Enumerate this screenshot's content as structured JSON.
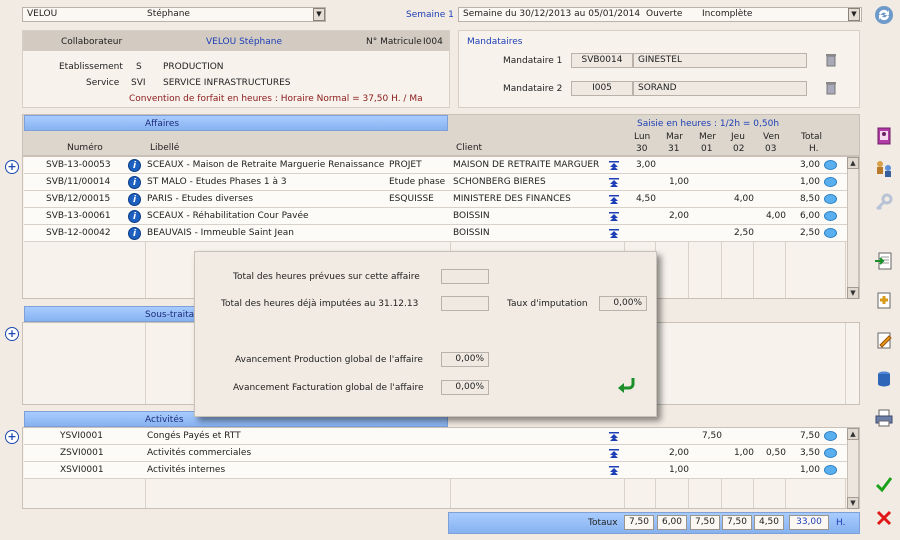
{
  "header": {
    "collaborator_select": "VELOU",
    "collaborator_firstname": "Stéphane",
    "week_label": "Semaine 1",
    "week_select": "Semaine du 30/12/2013 au 05/01/2014",
    "week_state": "Ouverte",
    "week_status": "Incomplète"
  },
  "collab": {
    "label": "Collaborateur",
    "name": "VELOU Stéphane",
    "matricule_label": "N° Matricule",
    "matricule": "I004",
    "etab_label": "Etablissement",
    "etab_code": "S",
    "etab_name": "PRODUCTION",
    "service_label": "Service",
    "service_code": "SVI",
    "service_name": "SERVICE INFRASTRUCTURES",
    "convention": "Convention de forfait en heures : Horaire Normal = 37,50 H. / Ma"
  },
  "mandataires": {
    "title": "Mandataires",
    "m1_label": "Mandataire 1",
    "m1_code": "SVB0014",
    "m1_name": "GINESTEL",
    "m2_label": "Mandataire 2",
    "m2_code": "I005",
    "m2_name": "SORAND"
  },
  "grid": {
    "affaires_band": "Affaires",
    "saisie": "Saisie en heures : 1/2h = 0,50h",
    "col_numero": "Numéro",
    "col_libelle": "Libellé",
    "col_client": "Client",
    "days": [
      {
        "name": "Lun",
        "num": "30"
      },
      {
        "name": "Mar",
        "num": "31"
      },
      {
        "name": "Mer",
        "num": "01"
      },
      {
        "name": "Jeu",
        "num": "02"
      },
      {
        "name": "Ven",
        "num": "03"
      }
    ],
    "col_total": "Total",
    "col_total_unit": "H.",
    "affaires": [
      {
        "num": "SVB-13-00053",
        "lib": "SCEAUX - Maison de Retraite Marguerie Renaissance",
        "phase": "PROJET",
        "client": "MAISON DE RETRAITE MARGUER",
        "d": [
          "3,00",
          "",
          "",
          "",
          ""
        ],
        "total": "3,00"
      },
      {
        "num": "SVB/11/00014",
        "lib": "ST MALO - Etudes Phases 1 à 3",
        "phase": "Etude phase",
        "client": "SCHONBERG BIERES",
        "d": [
          "",
          "1,00",
          "",
          "",
          ""
        ],
        "total": "1,00"
      },
      {
        "num": "SVB/12/00015",
        "lib": "PARIS - Etudes diverses",
        "phase": "ESQUISSE",
        "client": "MINISTERE DES FINANCES",
        "d": [
          "4,50",
          "",
          "",
          "4,00",
          ""
        ],
        "total": "8,50"
      },
      {
        "num": "SVB-13-00061",
        "lib": "SCEAUX - Réhabilitation Cour Pavée",
        "phase": "",
        "client": "BOISSIN",
        "d": [
          "",
          "2,00",
          "",
          "",
          "4,00"
        ],
        "total": "6,00"
      },
      {
        "num": "SVB-12-00042",
        "lib": "BEAUVAIS - Immeuble Saint Jean",
        "phase": "",
        "client": "BOISSIN",
        "d": [
          "",
          "",
          "",
          "2,50",
          ""
        ],
        "total": "2,50"
      }
    ],
    "sous_band": "Sous-traitan",
    "activites_band": "Activités",
    "activites": [
      {
        "num": "YSVI0001",
        "lib": "Congés Payés et RTT",
        "d": [
          "",
          "",
          "7,50",
          "",
          ""
        ],
        "total": "7,50"
      },
      {
        "num": "ZSVI0001",
        "lib": "Activités commerciales",
        "d": [
          "",
          "2,00",
          "",
          "1,00",
          "0,50"
        ],
        "total": "3,50"
      },
      {
        "num": "XSVI0001",
        "lib": "Activités internes",
        "d": [
          "",
          "1,00",
          "",
          "",
          ""
        ],
        "total": "1,00"
      }
    ],
    "totaux_label": "Totaux",
    "totaux": [
      "7,50",
      "6,00",
      "7,50",
      "7,50",
      "4,50"
    ],
    "totaux_total": "33,00",
    "totaux_unit": "H."
  },
  "popup": {
    "l1": "Total des heures prévues sur cette affaire",
    "v1": "",
    "l2": "Total des heures déjà imputées au 31.12.13",
    "v2": "",
    "taux_label": "Taux d'imputation",
    "taux": "0,00%",
    "l3": "Avancement Production global de l'affaire",
    "v3": "0,00%",
    "l4": "Avancement Facturation global de l'affaire",
    "v4": "0,00%"
  },
  "colors": {
    "accent": "#1d3fb6",
    "band": "#a9ccff",
    "ok": "#1aa31a",
    "cancel": "#e01818"
  }
}
